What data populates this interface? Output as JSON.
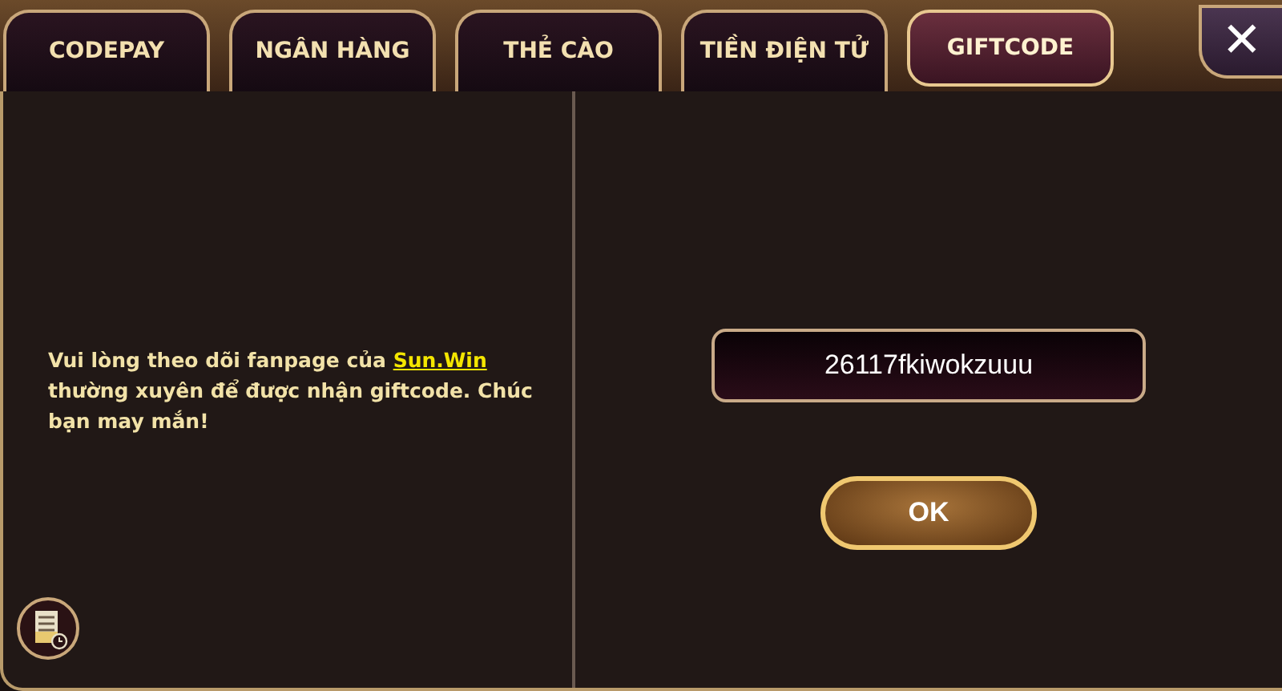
{
  "tabs": [
    {
      "label": "CODEPAY",
      "selected": false
    },
    {
      "label": "NGÂN HÀNG",
      "selected": false
    },
    {
      "label": "THẺ CÀO",
      "selected": false
    },
    {
      "label": "TIỀN ĐIỆN TỬ",
      "selected": false
    },
    {
      "label": "GIFTCODE",
      "selected": true
    }
  ],
  "close_button": {
    "label": "✕"
  },
  "notice": {
    "before": "Vui lòng theo dõi fanpage của ",
    "link": "Sun.Win",
    "after": " thường xuyên để được nhận giftcode. Chúc bạn may mắn!"
  },
  "giftcode_field": {
    "value": "26117fkiwokzuuu"
  },
  "ok_button": {
    "label": "OK"
  }
}
